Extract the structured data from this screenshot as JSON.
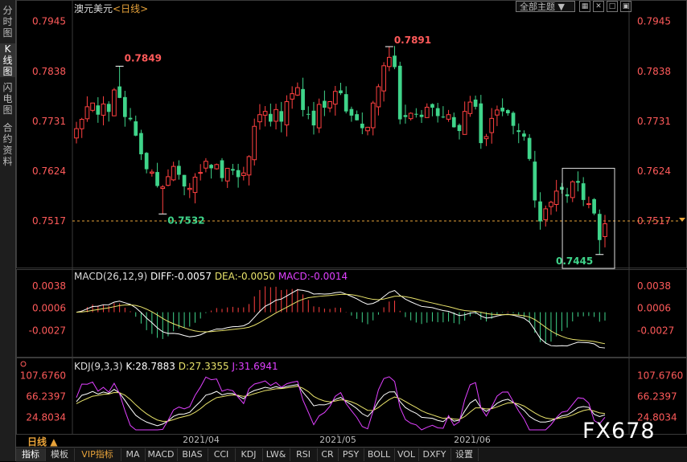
{
  "instrument": "澳元美元",
  "period": "<日线>",
  "theme_dropdown": "全部主题",
  "sidebar_tabs": [
    {
      "label": "分时图"
    },
    {
      "label": "K线图"
    },
    {
      "label": "闪电图"
    },
    {
      "label": "合约资料"
    }
  ],
  "price_axis": {
    "ticks": [
      "0.7945",
      "0.7838",
      "0.7731",
      "0.7624",
      "0.7517"
    ],
    "current": "0.7517"
  },
  "annotations": {
    "high1": "0.7849",
    "high2": "0.7891",
    "low1": "0.7532",
    "low2": "0.7445"
  },
  "macd_title": {
    "name": "MACD(26,12,9)",
    "diff": "DIFF:-0.0057",
    "dea": "DEA:-0.0050",
    "macd": "MACD:-0.0014"
  },
  "macd_axis": [
    "0.0038",
    "0.0006",
    "-0.0027"
  ],
  "kdj_title": {
    "name": "KDJ(9,3,3)",
    "k": "K:28.7883",
    "d": "D:27.3355",
    "j": "J:31.6941"
  },
  "kdj_axis": [
    "107.6760",
    "66.2397",
    "24.8034"
  ],
  "date_labels": [
    "2021/04",
    "2021/05",
    "2021/06"
  ],
  "period_label": "日线",
  "bottom_tabs": [
    "指标",
    "模板",
    "VIP指标",
    "MA",
    "MACD",
    "BIAS",
    "CCI",
    "KDJ",
    "LW&",
    "RSI",
    "CR",
    "PSY",
    "BOLL",
    "VOL",
    "DXFY",
    "设置"
  ],
  "watermark": "FX678",
  "colors": {
    "up": "#ff4040",
    "down": "#3fd48a",
    "diff": "#ffffff",
    "dea": "#e9e36b",
    "macd": "#e040ff",
    "accent": "#e8a33a",
    "price_text": "#ff5a5a"
  },
  "chart_data": {
    "type": "candlestick",
    "price_range": [
      0.7417,
      0.796
    ],
    "ohlc_closes": [
      0.7715,
      0.7735,
      0.7762,
      0.777,
      0.7745,
      0.7768,
      0.7751,
      0.7798,
      0.7781,
      0.774,
      0.7735,
      0.77,
      0.766,
      0.7628,
      0.7622,
      0.7592,
      0.759,
      0.7612,
      0.7634,
      0.7616,
      0.7591,
      0.7587,
      0.7611,
      0.7621,
      0.7645,
      0.763,
      0.7638,
      0.7609,
      0.763,
      0.7625,
      0.7611,
      0.762,
      0.7655,
      0.772,
      0.7745,
      0.7752,
      0.773,
      0.7756,
      0.773,
      0.7773,
      0.779,
      0.7803,
      0.7755,
      0.7745,
      0.7722,
      0.7767,
      0.776,
      0.7773,
      0.7795,
      0.7791,
      0.7752,
      0.7743,
      0.7733,
      0.7716,
      0.7718,
      0.777,
      0.7805,
      0.785,
      0.7868,
      0.7847,
      0.7735,
      0.774,
      0.7748,
      0.7745,
      0.774,
      0.7761,
      0.776,
      0.7742,
      0.774,
      0.7745,
      0.7718,
      0.771,
      0.7752,
      0.7772,
      0.7762,
      0.7684,
      0.7698,
      0.7737,
      0.7755,
      0.7752,
      0.7748,
      0.7721,
      0.7708,
      0.7698,
      0.765,
      0.7561,
      0.7516,
      0.7543,
      0.7557,
      0.7581,
      0.7584,
      0.757,
      0.7601,
      0.7599,
      0.7562,
      0.7554,
      0.7533,
      0.7476,
      0.7511
    ],
    "macd_diff_range": [
      -0.006,
      0.0045
    ],
    "kdj_range": [
      0,
      120
    ],
    "summary": {
      "high": 0.7891,
      "low": 0.7445,
      "last_diff": -0.0057,
      "last_dea": -0.005,
      "last_macd": -0.0014,
      "last_k": 28.7883,
      "last_d": 27.3355,
      "last_j": 31.6941
    }
  }
}
